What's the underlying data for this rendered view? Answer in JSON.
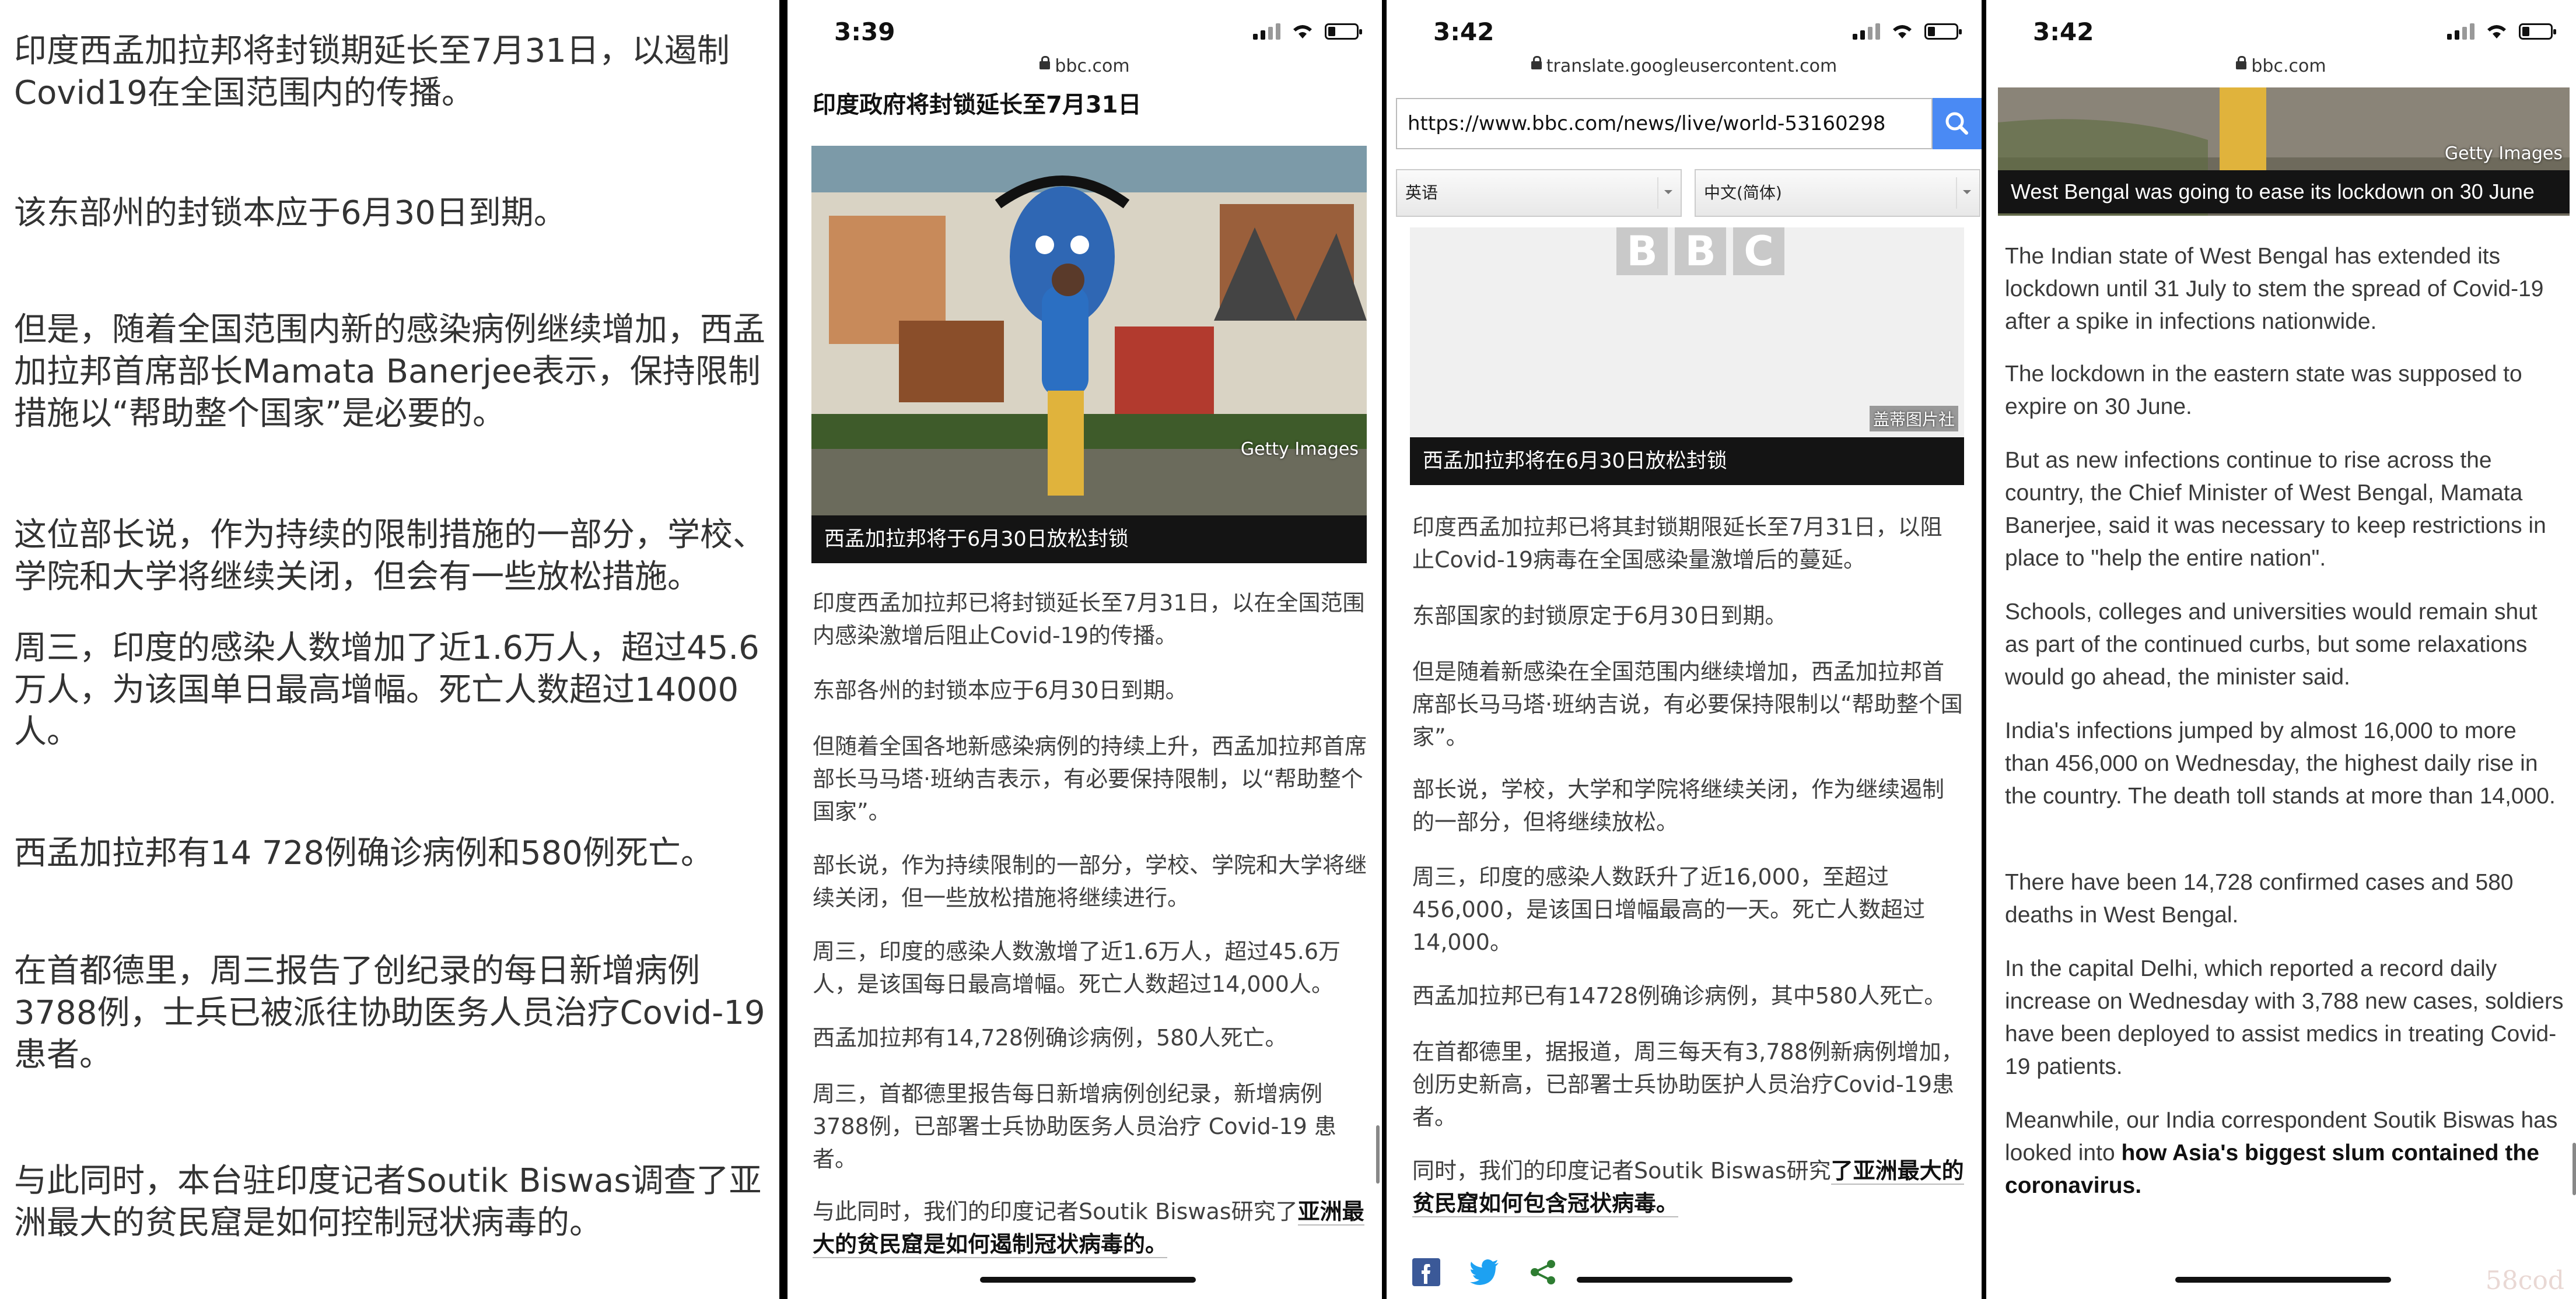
{
  "panel1": {
    "paragraphs": [
      "印度西孟加拉邦将封锁期延长至7月31日，以遏制Covid19在全国范围内的传播。",
      "该东部州的封锁本应于6月30日到期。",
      "但是，随着全国范围内新的感染病例继续增加，西孟加拉邦首席部长Mamata Banerjee表示，保持限制措施以“帮助整个国家”是必要的。",
      "这位部长说，作为持续的限制措施的一部分，学校、学院和大学将继续关闭，但会有一些放松措施。",
      "周三，印度的感染人数增加了近1.6万人，超过45.6万人，为该国单日最高增幅。死亡人数超过14000人。",
      "西孟加拉邦有14 728例确诊病例和580例死亡。",
      "在首都德里，周三报告了创纪录的每日新增病例3788例，士兵已被派往协助医务人员治疗Covid-19患者。",
      "与此同时，本台驻印度记者Soutik Biswas调查了亚洲最大的贫民窟是如何控制冠状病毒的。"
    ]
  },
  "panel2": {
    "time": "3:39",
    "url": "bbc.com",
    "headline": "印度政府将封锁延长至7月31日",
    "image_credit": "Getty Images",
    "caption": "西孟加拉邦将于6月30日放松封锁",
    "paragraphs": [
      "印度西孟加拉邦已将封锁延长至7月31日，以在全国范围内感染激增后阻止Covid-19的传播。",
      "东部各州的封锁本应于6月30日到期。",
      "但随着全国各地新感染病例的持续上升，西孟加拉邦首席部长马马塔·班纳吉表示，有必要保持限制，以“帮助整个国家”。",
      "部长说，作为持续限制的一部分，学校、学院和大学将继续关闭，但一些放松措施将继续进行。",
      "周三，印度的感染人数激增了近1.6万人，超过45.6万人，是该国每日最高增幅。死亡人数超过14,000人。",
      "西孟加拉邦有14,728例确诊病例，580人死亡。",
      "周三，首都德里报告每日新增病例创纪录，新增病例3788例，已部署士兵协助医务人员治疗 Covid-19 患者。"
    ],
    "last_para_prefix": "与此同时，我们的印度记者Soutik Biswas研究了",
    "last_para_link": "亚洲最大的贫民窟是如何遏制冠状病毒的。"
  },
  "panel3": {
    "time": "3:42",
    "url": "translate.googleusercontent.com",
    "input_value": "https://www.bbc.com/news/live/world-53160298",
    "source_lang": "英语",
    "target_lang": "中文(简体)",
    "bbc_letters": [
      "B",
      "B",
      "C"
    ],
    "image_credit": "盖蒂图片社",
    "caption": "西孟加拉邦将在6月30日放松封锁",
    "paragraphs": [
      "印度西孟加拉邦已将其封锁期限延长至7月31日，以阻止Covid-19病毒在全国感染量激增后的蔓延。",
      "东部国家的封锁原定于6月30日到期。",
      "但是随着新感染在全国范围内继续增加，西孟加拉邦首席部长马马塔·班纳吉说，有必要保持限制以“帮助整个国家”。",
      "部长说，学校，大学和学院将继续关闭，作为继续遏制的一部分，但将继续放松。",
      "周三，印度的感染人数跃升了近16,000，至超过456,000，是该国日增幅最高的一天。死亡人数超过14,000。",
      "西孟加拉邦已有14728例确诊病例，其中580人死亡。",
      "在首都德里，据报道，周三每天有3,788例新病例增加，创历史新高，已部署士兵协助医护人员治疗Covid-19患者。"
    ],
    "last_para_prefix": "同时，我们的印度记者Soutik Biswas研究",
    "last_para_link": "了亚洲最大的贫民窟如何包含冠状病毒。",
    "colors": {
      "facebook": "#3b5998",
      "twitter": "#1da1f2",
      "share": "#2e7d32"
    }
  },
  "panel4": {
    "time": "3:42",
    "url": "bbc.com",
    "image_credit": "Getty Images",
    "caption": "West Bengal was going to ease its lockdown on 30 June",
    "paragraphs": [
      "The Indian state of West Bengal has extended its lockdown until 31 July to stem the spread of Covid-19 after a spike in infections nationwide.",
      "The lockdown in the eastern state was supposed to expire on 30 June.",
      "But as new infections continue to rise across the country, the Chief Minister of West Bengal, Mamata Banerjee, said it was necessary to keep restrictions in place to \"help the entire nation\".",
      "Schools, colleges and universities would remain shut as part of the continued curbs, but some relaxations would go ahead, the minister said.",
      "India's infections jumped by almost 16,000 to more than 456,000 on Wednesday, the highest daily rise in the country. The death toll stands at more than 14,000.",
      "There have been 14,728 confirmed cases and 580 deaths in West Bengal.",
      "In the capital Delhi, which reported a record daily increase on Wednesday with 3,788 new cases, soldiers have been deployed to assist medics in treating Covid-19 patients."
    ],
    "last_para_prefix": "Meanwhile, our India correspondent Soutik Biswas has looked into ",
    "last_para_link": "how Asia's biggest slum contained the coronavirus.",
    "watermark": "58cod"
  }
}
